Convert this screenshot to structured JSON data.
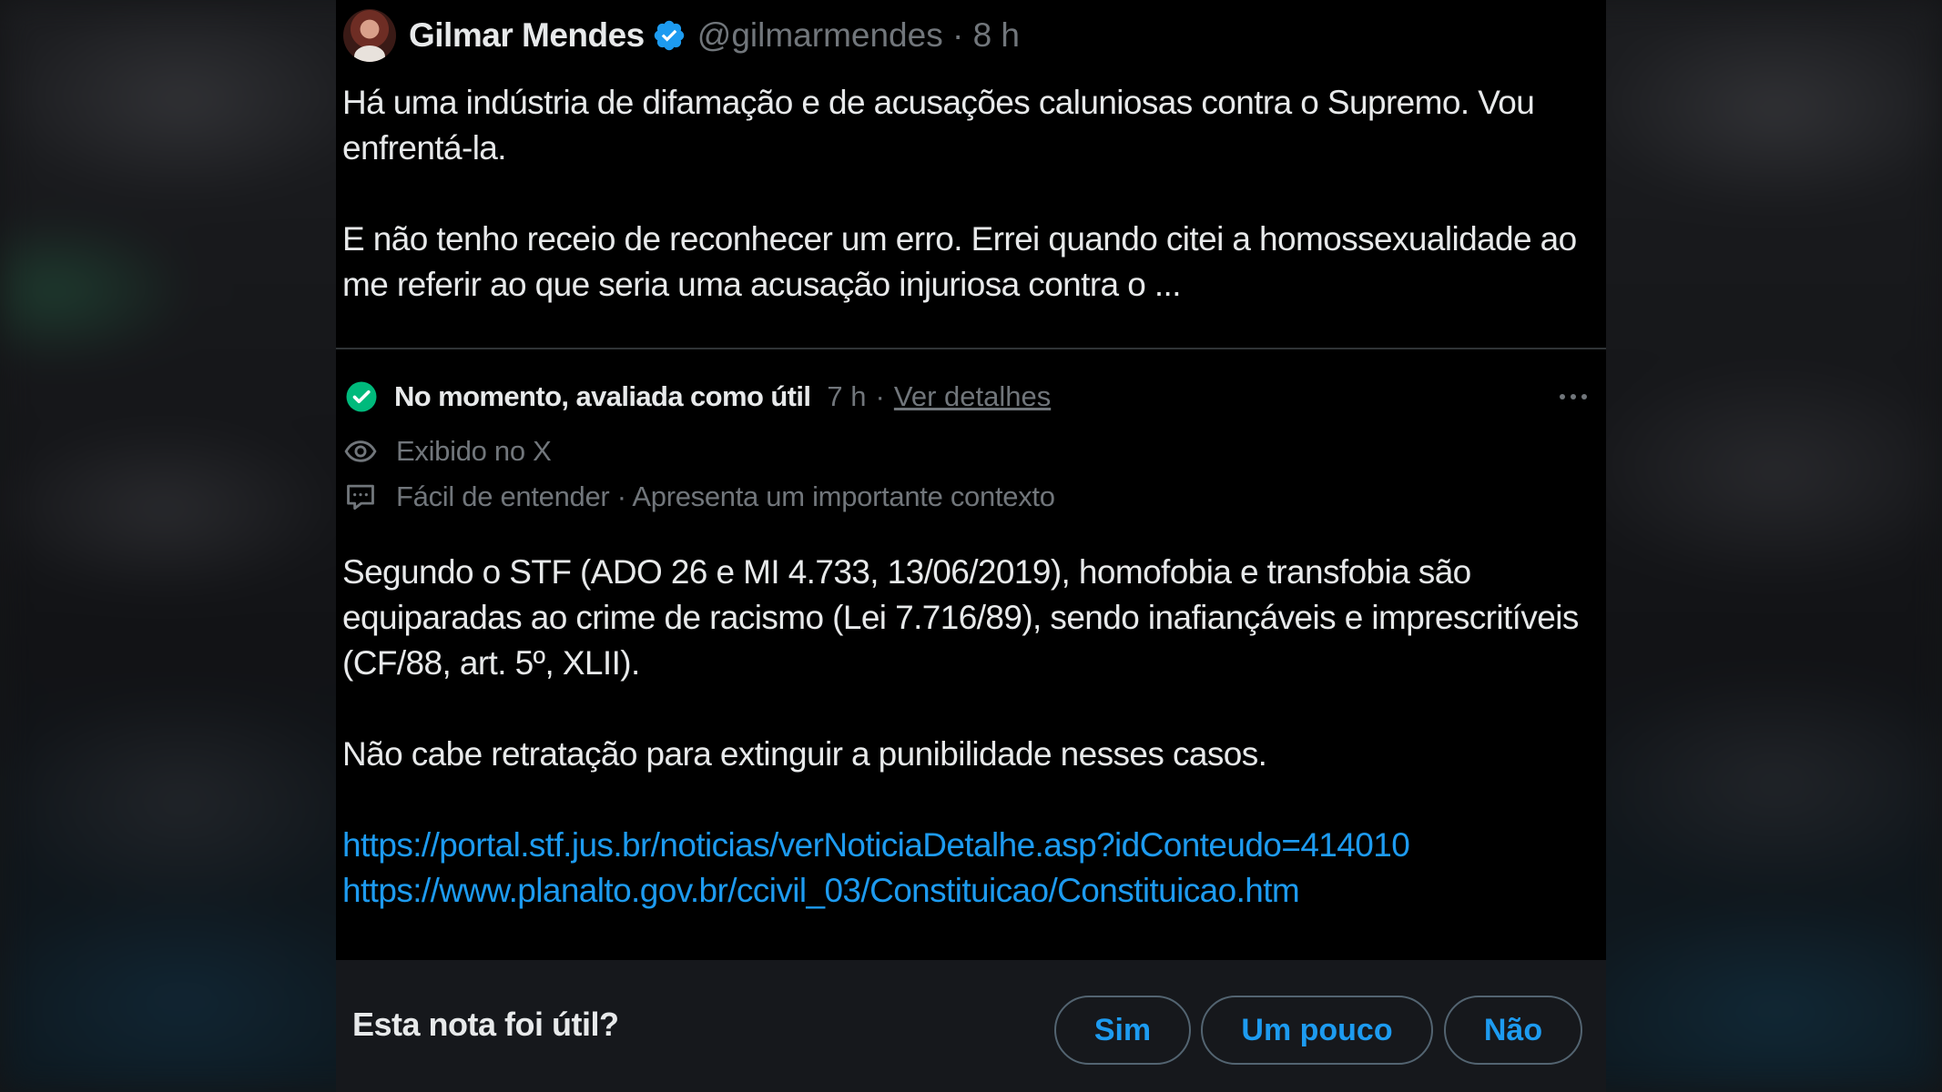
{
  "tweet": {
    "author_name": "Gilmar Mendes",
    "handle_time": "@gilmarmendes · 8 h",
    "paragraphs": [
      "Há uma indústria de difamação e de acusações caluniosas contra o Supremo. Vou enfrentá-la.",
      "E não tenho receio de reconhecer um erro. Errei quando citei a homossexualidade ao me referir ao que seria uma acusação injuriosa contra o ..."
    ]
  },
  "note": {
    "status_label": "No momento, avaliada como útil",
    "time": "7 h",
    "separator": "·",
    "details_link": "Ver detalhes",
    "shown_on": "Exibido no X",
    "tags": "Fácil de entender · Apresenta um importante contexto",
    "paragraphs": [
      "Segundo o STF (ADO 26 e MI 4.733, 13/06/2019), homofobia e transfobia são equiparadas ao crime de racismo (Lei 7.716/89), sendo inafiançáveis e imprescritíveis (CF/88, art. 5º, XLII).",
      "Não cabe retratação para extinguir a punibilidade nesses casos."
    ],
    "links": [
      "https://portal.stf.jus.br/noticias/verNoticiaDetalhe.asp?idConteudo=414010",
      "https://www.planalto.gov.br/ccivil_03/Constituicao/Constituicao.htm"
    ]
  },
  "rating": {
    "question": "Esta nota foi útil?",
    "yes_label": "Sim",
    "somewhat_label": "Um pouco",
    "no_label": "Não"
  },
  "colors": {
    "accent": "#1d9bf0",
    "verified": "#1d9bf0",
    "helpful_green": "#00ba7c",
    "muted": "#71767b"
  }
}
